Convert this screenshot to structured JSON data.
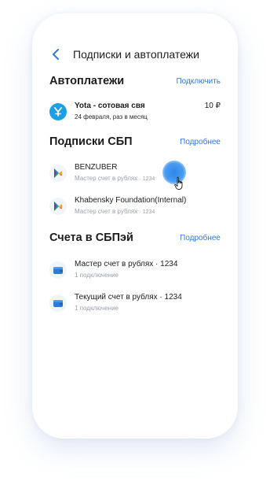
{
  "header": {
    "title": "Подписки и автоплатежи",
    "back_icon": "chevron-left-icon"
  },
  "colors": {
    "accent": "#2f7bd8",
    "yota_icon_bg": "#1aa0e6",
    "card_icon_blue": "#2f7bd8"
  },
  "autopayments": {
    "title": "Автоплатежи",
    "link": "Подключить",
    "items": [
      {
        "icon": "yota-icon",
        "title": "Yota - сотовая свя",
        "subtitle": "24 февраля, раз в месяц",
        "amount": "10 ₽"
      }
    ]
  },
  "sbp_subscriptions": {
    "title": "Подписки СБП",
    "link": "Подробнее",
    "items": [
      {
        "icon": "sbp-icon",
        "title": "BENZUBER",
        "subtitle": "Мастер счет в рублях",
        "subtitle_suffix": "· 1234"
      },
      {
        "icon": "sbp-icon",
        "title": "Khabensky Foundation(Internal)",
        "subtitle": "Мастер счет в рублях",
        "subtitle_suffix": "· 1234"
      }
    ]
  },
  "sbpay_accounts": {
    "title": "Счета в СБПэй",
    "link": "Подробнее",
    "items": [
      {
        "icon": "wallet-icon",
        "title": "Мастер счет в рублях",
        "title_suffix": "· 1234",
        "subtitle": "1 подключение"
      },
      {
        "icon": "wallet-icon",
        "title": "Текущий счет в рублях",
        "title_suffix": "· 1234",
        "subtitle": "1 подключение"
      }
    ]
  }
}
